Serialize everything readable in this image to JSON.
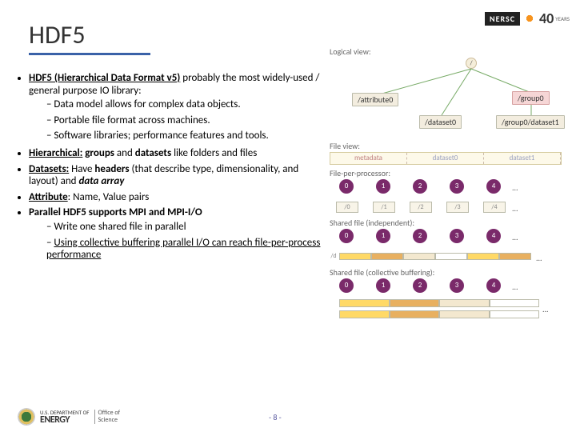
{
  "title": "HDF5",
  "logo": {
    "brand": "NERSC",
    "forty": "40",
    "years": "YEARS"
  },
  "bullets": {
    "b1_bold": "HDF5 (Hierarchical Data Format v5)",
    "b1_rest": " probably the most widely-used / general purpose IO library:",
    "b1_subs": [
      "Data model allows for complex data objects.",
      "Portable file format across machines.",
      "Software libraries; performance features and tools."
    ],
    "b2_parts": [
      "Hierarchical:",
      " groups",
      " and ",
      "datasets",
      " like folders and files"
    ],
    "b3_parts": [
      "Datasets:",
      " Have ",
      "headers",
      " (that describe type, dimensionality, and layout) and ",
      "data array"
    ],
    "b4_parts": [
      "Attribute",
      ": Name, Value pairs"
    ],
    "b5": "Parallel HDF5 supports MPI and MPI-I/O",
    "b5_subs": [
      "Write one shared file in parallel",
      "Using collective buffering parallel I/O can reach file-per-process performance"
    ]
  },
  "diagrams": {
    "logical_label": "Logical view:",
    "root": "/",
    "attribute0": "/attribute0",
    "dataset0": "/dataset0",
    "group0": "/group0",
    "group0_dataset1": "/group0/dataset1",
    "file_label": "File view:",
    "file_segs": [
      "metadata",
      "dataset0",
      "dataset1"
    ],
    "fpp_label": "File-per-processor:",
    "sfi_label": "Shared file (independent):",
    "sfb_label": "Shared file (collective buffering):",
    "procs": [
      "0",
      "1",
      "2",
      "3",
      "4"
    ],
    "files": [
      "/0",
      "/1",
      "/2",
      "/3",
      "/4"
    ],
    "shared": "/d",
    "dots": "..."
  },
  "footer": {
    "doe_small": "U.S. DEPARTMENT OF",
    "doe_big": "ENERGY",
    "office1": "Office of",
    "office2": "Science",
    "page": "- 8 -"
  }
}
